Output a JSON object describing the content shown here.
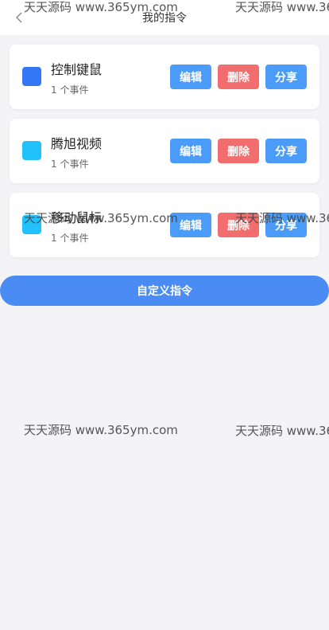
{
  "header": {
    "title": "我的指令"
  },
  "commands": [
    {
      "name": "控制键鼠",
      "count": "1 个事件",
      "color": "#3478f6"
    },
    {
      "name": "腾旭视频",
      "count": "1 个事件",
      "color": "#21c1fb"
    },
    {
      "name": "移动鼠标",
      "count": "1 个事件",
      "color": "#21c1fb"
    }
  ],
  "actions": {
    "edit": "编辑",
    "delete": "删除",
    "share": "分享"
  },
  "custom_button": "自定义指令",
  "watermark": "天天源码 www.365ym.com",
  "colors": {
    "primary": "#4a9cf8",
    "danger": "#f26d6d",
    "background": "#f4f4f6"
  }
}
